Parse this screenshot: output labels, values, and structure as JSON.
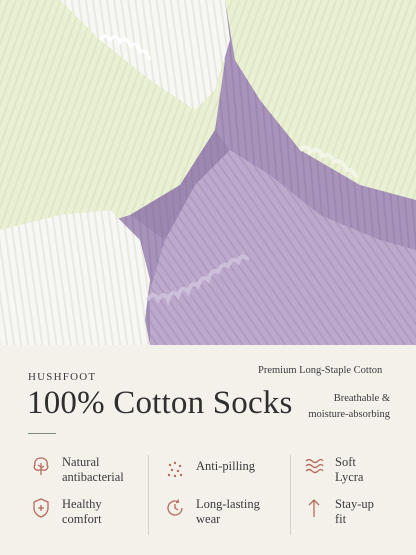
{
  "brand": "HUSHFOOT",
  "subhead": "Premium Long-Staple Cotton",
  "headline": "100% Cotton Socks",
  "tagline_line1": "Breathable &",
  "tagline_line2": "moisture-absorbing",
  "features": [
    {
      "line1": "Natural",
      "line2": "antibacterial",
      "icon": "tree-icon"
    },
    {
      "line1": "Anti-pilling",
      "line2": "",
      "icon": "dots-icon"
    },
    {
      "line1": "Soft",
      "line2": "Lycra",
      "icon": "waves-icon"
    },
    {
      "line1": "Healthy",
      "line2": "comfort",
      "icon": "shield-plus-icon"
    },
    {
      "line1": "Long-lasting",
      "line2": "wear",
      "icon": "clock-icon"
    },
    {
      "line1": "Stay-up",
      "line2": "fit",
      "icon": "arrow-up-icon"
    }
  ],
  "colors": {
    "accent": "#b56b5d",
    "sock_green": "#eaf0d6",
    "sock_purple": "#b9a7c9",
    "sock_white": "#f6f6f2"
  }
}
